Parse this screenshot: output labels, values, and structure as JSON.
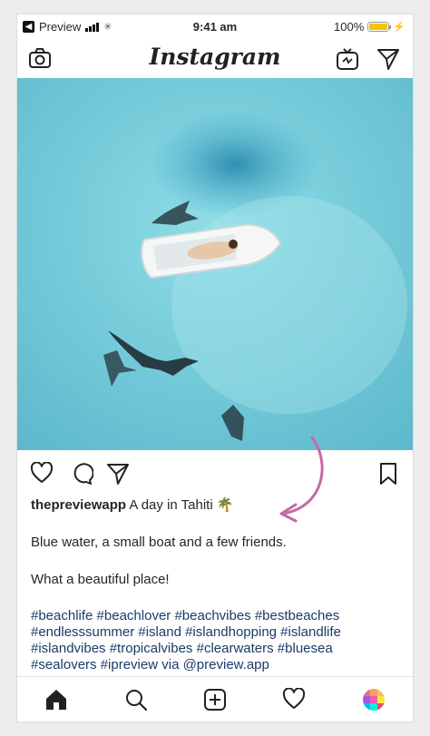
{
  "status_bar": {
    "back_label": "Preview",
    "time": "9:41 am",
    "battery_text": "100%",
    "battery_level": 1.0
  },
  "nav": {
    "logo_text": "Instagram",
    "icons": [
      "camera-icon",
      "igtv-icon",
      "direct-message-icon"
    ]
  },
  "post": {
    "photo_description_icon": "beach-photo",
    "username": "thepreviewapp",
    "caption_title": "A day in Tahiti 🌴",
    "body_lines": [
      "Blue water, a small boat and a few friends.",
      "What a beautiful place!"
    ],
    "hashtags_lines": [
      "#beachlife #beachlover #beachvibes #bestbeaches",
      "#endlesssummer #island #islandhopping #islandlife",
      "#islandvibes #tropicalvibes #clearwaters #bluesea",
      "#sealovers #ipreview via @preview.app"
    ]
  },
  "actions": [
    "heart-icon",
    "comment-icon",
    "share-icon",
    "bookmark-icon"
  ],
  "tabbar": [
    "home-icon",
    "search-icon",
    "add-post-icon",
    "activity-heart-icon",
    "profile-grid-icon"
  ],
  "colors": {
    "water": "#6fc6d6",
    "annotation_arrow": "#c46aa6",
    "hashtag": "#1b3a6b",
    "battery": "#f5c400"
  }
}
